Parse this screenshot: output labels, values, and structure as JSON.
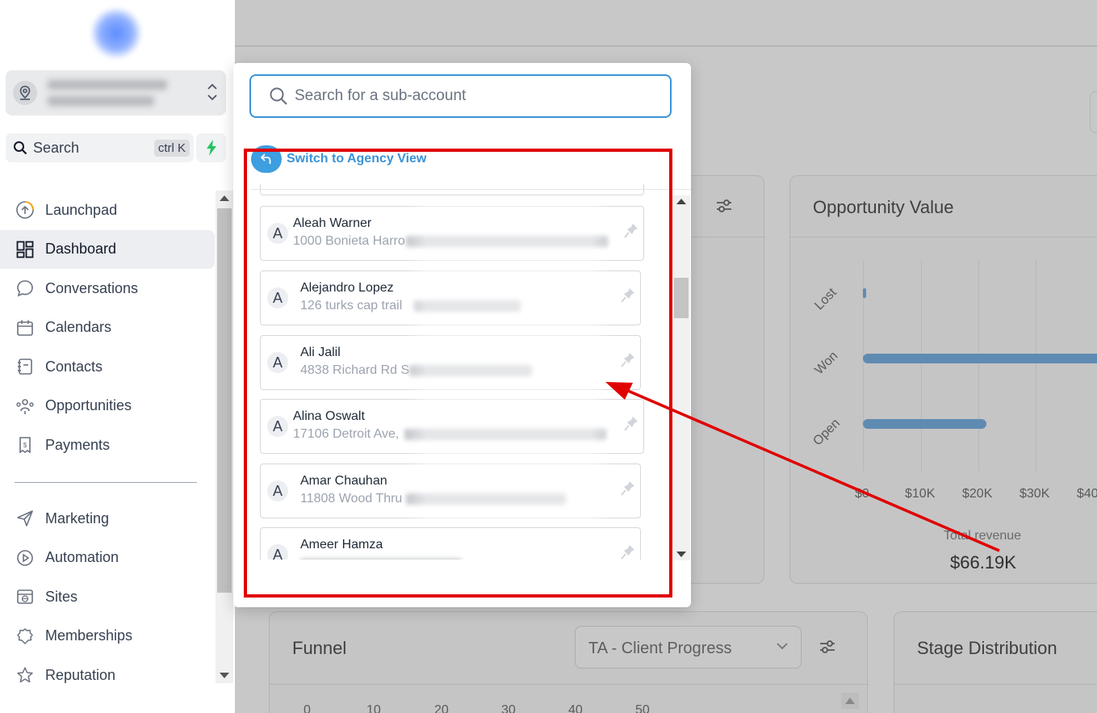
{
  "sidebar": {
    "search_label": "Search",
    "search_shortcut": "ctrl K",
    "items": [
      {
        "label": "Launchpad",
        "icon": "launchpad-icon"
      },
      {
        "label": "Dashboard",
        "icon": "dashboard-icon",
        "active": true
      },
      {
        "label": "Conversations",
        "icon": "chat-icon"
      },
      {
        "label": "Calendars",
        "icon": "calendar-icon"
      },
      {
        "label": "Contacts",
        "icon": "contacts-icon"
      },
      {
        "label": "Opportunities",
        "icon": "opportunities-icon"
      },
      {
        "label": "Payments",
        "icon": "payments-icon"
      }
    ],
    "items2": [
      {
        "label": "Marketing",
        "icon": "send-icon"
      },
      {
        "label": "Automation",
        "icon": "automation-icon"
      },
      {
        "label": "Sites",
        "icon": "sites-icon"
      },
      {
        "label": "Memberships",
        "icon": "memberships-icon"
      },
      {
        "label": "Reputation",
        "icon": "star-icon"
      }
    ]
  },
  "popup": {
    "search_placeholder": "Search for a sub-account",
    "agency_label": "Switch to Agency View",
    "accounts": [
      {
        "initial": "A",
        "name": "Aleah Warner",
        "address": "1000 Bonieta Harro"
      },
      {
        "initial": "A",
        "name": "Alejandro Lopez",
        "address": "126 turks cap trail"
      },
      {
        "initial": "A",
        "name": "Ali Jalil",
        "address": "4838 Richard Rd S"
      },
      {
        "initial": "A",
        "name": "Alina Oswalt",
        "address": "17106 Detroit Ave,"
      },
      {
        "initial": "A",
        "name": "Amar Chauhan",
        "address": "11808 Wood Thru"
      },
      {
        "initial": "A",
        "name": "Ameer Hamza",
        "address": ""
      }
    ]
  },
  "dashboard": {
    "opportunity_card": {
      "title": "Opportunity Value",
      "categories": [
        "Lost",
        "Won",
        "Open"
      ],
      "x_ticks": [
        "$0",
        "$10K",
        "$20K",
        "$30K",
        "$40"
      ],
      "total_label": "Total revenue",
      "total_value": "$66.19K"
    },
    "funnel_card": {
      "title": "Funnel",
      "pipeline_select": "TA - Client Progress",
      "ticks": [
        "0",
        "10",
        "20",
        "30",
        "40",
        "50"
      ]
    },
    "stage_card": {
      "title": "Stage Distribution"
    }
  },
  "colors": {
    "accent": "#3b93d6",
    "highlight": "#e00000",
    "bar": "#5f8bb3"
  }
}
